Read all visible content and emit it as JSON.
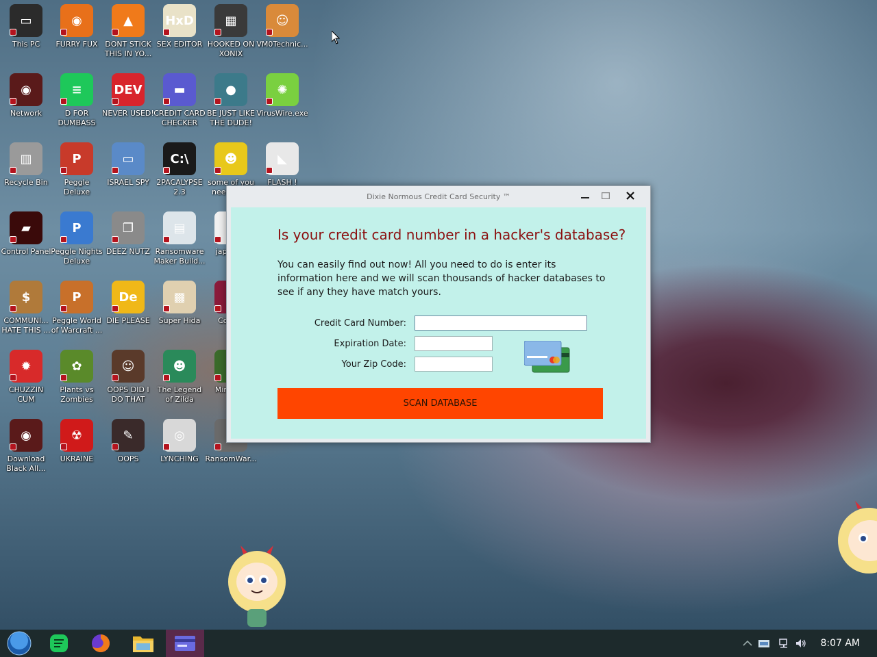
{
  "desktop": {
    "icons": [
      {
        "label": "This PC",
        "color": "#2b2b2b",
        "glyph": "▭"
      },
      {
        "label": "FURRY FUX",
        "color": "#e8701a",
        "glyph": "◉"
      },
      {
        "label": "DONT STICK THIS IN YO...",
        "color": "#f07a1a",
        "glyph": "▲"
      },
      {
        "label": "SEX EDITOR",
        "color": "#e9e2c8",
        "glyph": "HxD"
      },
      {
        "label": "HOOKED ON XONIX",
        "color": "#3a3a3a",
        "glyph": "▦"
      },
      {
        "label": "VM0Technic...",
        "color": "#d98a3a",
        "glyph": "☺"
      },
      {
        "label": "Network",
        "color": "#5a1a1a",
        "glyph": "◉"
      },
      {
        "label": "D FOR DUMBASS",
        "color": "#1ec85a",
        "glyph": "≡"
      },
      {
        "label": "NEVER USED!",
        "color": "#d8242c",
        "glyph": "DEV"
      },
      {
        "label": "CREDIT CARD CHECKER",
        "color": "#5a5ad0",
        "glyph": "▬"
      },
      {
        "label": "BE JUST LIKE THE DUDE!",
        "color": "#3c7a8a",
        "glyph": "●"
      },
      {
        "label": "VirusWire.exe",
        "color": "#7ad040",
        "glyph": "✺"
      },
      {
        "label": "Recycle Bin",
        "color": "#9a9a9a",
        "glyph": "▥"
      },
      {
        "label": "Peggle Deluxe",
        "color": "#c83a2a",
        "glyph": "P"
      },
      {
        "label": "ISRAEL SPY",
        "color": "#5a8ac8",
        "glyph": "▭"
      },
      {
        "label": "2PACALYPSE 2.3",
        "color": "#1a1a1a",
        "glyph": "C:\\"
      },
      {
        "label": "some of you need to ...",
        "color": "#e8c81a",
        "glyph": "☻"
      },
      {
        "label": "FLASH !",
        "color": "#e8e8e8",
        "glyph": "◣"
      },
      {
        "label": "Control Panel",
        "color": "#3a0a0a",
        "glyph": "▰"
      },
      {
        "label": "Peggle Nights Deluxe",
        "color": "#3a7ad0",
        "glyph": "P"
      },
      {
        "label": "DEEZ NUTZ",
        "color": "#8a8a8a",
        "glyph": "❐"
      },
      {
        "label": "Ransomware Maker Build...",
        "color": "#dde5ea",
        "glyph": "▤"
      },
      {
        "label": "japan ...",
        "color": "#f0f0f0",
        "glyph": "▯"
      },
      {
        "label": "COMMUNI... HATE THIS ...",
        "color": "#b07a3a",
        "glyph": "$"
      },
      {
        "label": "Peggle World of Warcraft ...",
        "color": "#c8702a",
        "glyph": "P"
      },
      {
        "label": "DIE PLEASE",
        "color": "#f0b818",
        "glyph": "De"
      },
      {
        "label": "Super Hida",
        "color": "#e0d0b0",
        "glyph": "▩"
      },
      {
        "label": "Colla...",
        "color": "#8a1a3a",
        "glyph": "▣"
      },
      {
        "label": "CHUZZIN CUM",
        "color": "#d82a2a",
        "glyph": "✹"
      },
      {
        "label": "Plants vs Zombies",
        "color": "#5a8a2a",
        "glyph": "✿"
      },
      {
        "label": "OOPS DID I DO THAT",
        "color": "#5a3a2a",
        "glyph": "☺"
      },
      {
        "label": "The Legend of Zilda",
        "color": "#2a8a5a",
        "glyph": "☻"
      },
      {
        "label": "Minecr...",
        "color": "#3a6a2a",
        "glyph": "▥"
      },
      {
        "label": "Download Black All...",
        "color": "#5a1a1a",
        "glyph": "◉"
      },
      {
        "label": "UKRAINE",
        "color": "#d01a1a",
        "glyph": "☢"
      },
      {
        "label": "OOPS",
        "color": "#3a2a2a",
        "glyph": "✎"
      },
      {
        "label": "LYNCHING",
        "color": "#d8d8d8",
        "glyph": "◎"
      },
      {
        "label": "RansomWar...",
        "color": "#6a6a6a",
        "glyph": "⚙"
      }
    ]
  },
  "dialog": {
    "title": "Dixie Normous Credit Card Security ™",
    "heading": "Is your credit card number in a hacker's database?",
    "description": "You can easily find out now! All you need to do is enter its information here and we will scan thousands of hacker databases to see if any they have match yours.",
    "fields": {
      "card_number_label": "Credit Card Number:",
      "card_number_value": "",
      "expiration_label": "Expiration Date:",
      "expiration_value": "",
      "zip_label": "Your Zip Code:",
      "zip_value": ""
    },
    "scan_button": "SCAN DATABASE",
    "minimize_glyph": "▁",
    "maximize_glyph": "▭",
    "close_glyph": "✕"
  },
  "taskbar": {
    "apps": [
      {
        "name": "start-orb",
        "color": "#2a7ad8"
      },
      {
        "name": "spotify-like-app",
        "color": "#1ec85a"
      },
      {
        "name": "firefox",
        "color": "#e8701a"
      },
      {
        "name": "file-explorer",
        "color": "#e8c040"
      },
      {
        "name": "credit-card-checker",
        "color": "#5a5ad0"
      }
    ],
    "tray": {
      "chevron_glyph": "⌃",
      "network_glyph": "▭",
      "volume_glyph": "🔊"
    },
    "clock": "8:07 AM"
  },
  "colors": {
    "accent_button": "#ff4500",
    "dialog_client_bg": "#c2f1ea",
    "heading_text": "#8b1010",
    "taskbar_bg": "#1d2a2c"
  }
}
